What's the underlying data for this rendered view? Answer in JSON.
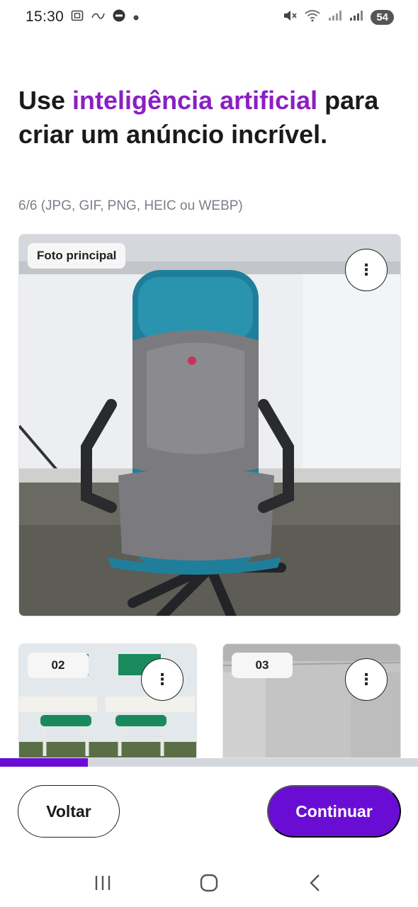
{
  "status_bar": {
    "time": "15:30",
    "battery": "54",
    "left_icons": [
      "screenshot-icon",
      "carrier-icon",
      "chat-icon",
      "dot-icon"
    ],
    "right_icons": [
      "mute-icon",
      "wifi-icon",
      "signal-icon",
      "signal-icon",
      "battery-icon"
    ]
  },
  "headline": {
    "part1": "Use ",
    "accent": "inteligência artificial",
    "part2": " para criar um anúncio incrível."
  },
  "subtitle": "6/6 (JPG, GIF, PNG, HEIC ou WEBP)",
  "main_photo": {
    "tag": "Foto principal",
    "menu_icon": "more-vertical-icon"
  },
  "thumbnails": [
    {
      "tag": "02",
      "menu_icon": "more-vertical-icon"
    },
    {
      "tag": "03",
      "menu_icon": "more-vertical-icon"
    }
  ],
  "progress": {
    "fraction": 0.21
  },
  "buttons": {
    "back": "Voltar",
    "continue": "Continuar"
  },
  "nav": [
    "recent-apps-icon",
    "home-icon",
    "back-icon"
  ],
  "colors": {
    "accent_text": "#8a1fc4",
    "primary": "#6a0dd4",
    "progress_track": "#d4d8de"
  }
}
